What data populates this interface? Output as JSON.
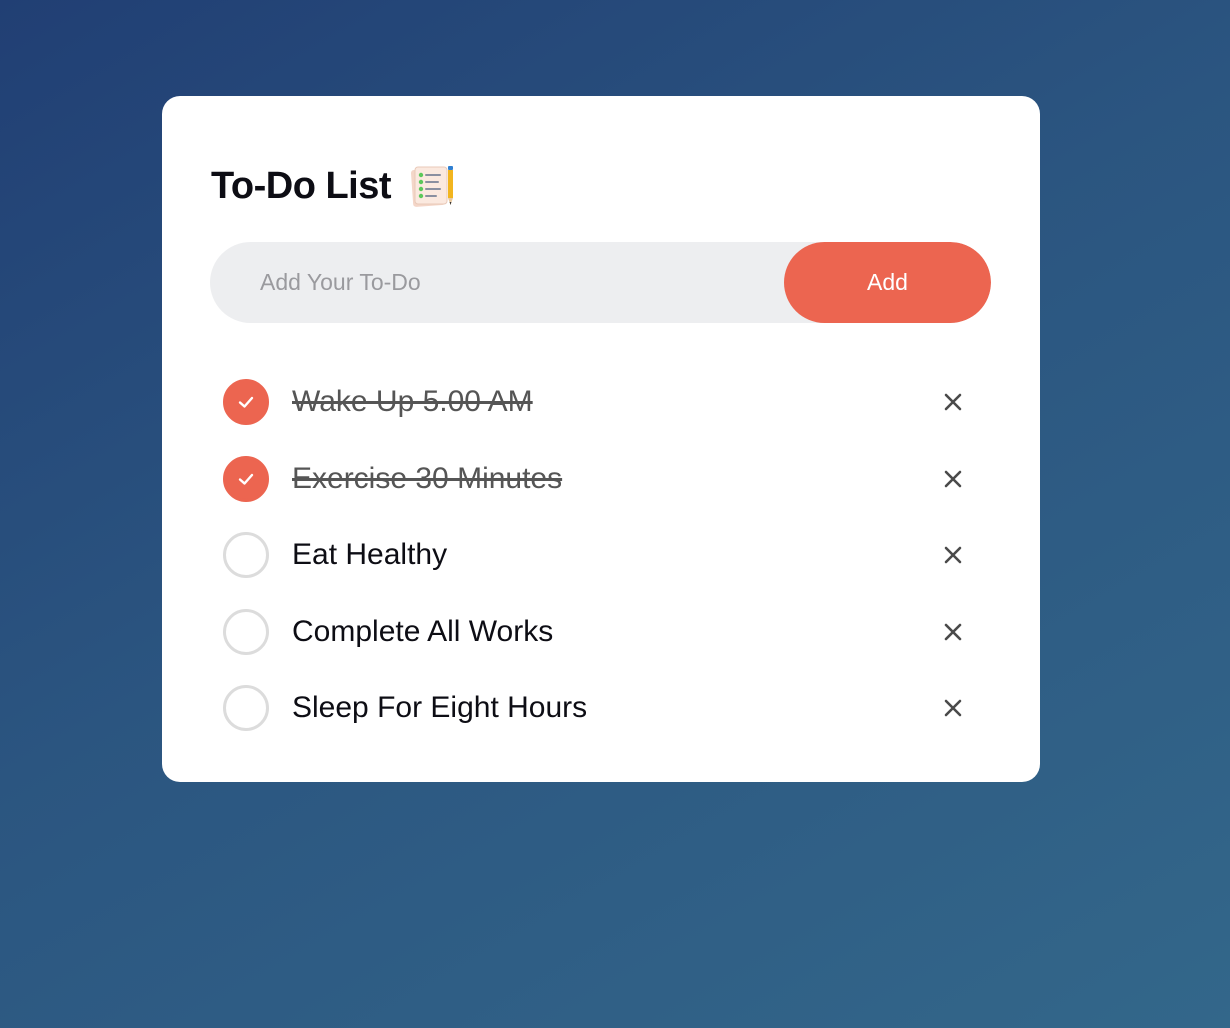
{
  "app": {
    "title": "To-Do List",
    "title_icon": "checklist-notepad-pencil-icon",
    "accent_color": "#ec6550"
  },
  "input": {
    "value": "",
    "placeholder": "Add Your To-Do"
  },
  "add_button": {
    "label": "Add"
  },
  "todos": [
    {
      "text": "Wake Up 5.00 AM",
      "done": true
    },
    {
      "text": "Exercise 30 Minutes",
      "done": true
    },
    {
      "text": "Eat Healthy",
      "done": false
    },
    {
      "text": "Complete All Works",
      "done": false
    },
    {
      "text": "Sleep For Eight Hours",
      "done": false
    }
  ],
  "icons": {
    "check": "checkmark-icon",
    "delete": "close-icon"
  }
}
